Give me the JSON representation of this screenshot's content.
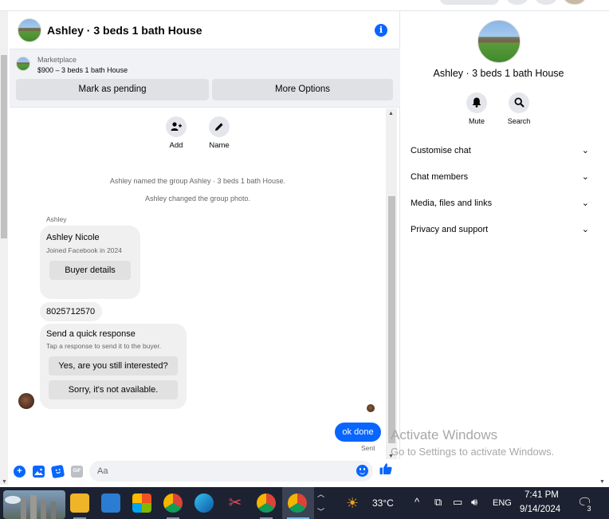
{
  "chat": {
    "title": "Ashley · 3 beds 1 bath House",
    "info_icon": "info-icon",
    "listing": {
      "label": "Marketplace",
      "price_title": "$900 – 3 beds 1 bath House",
      "mark_pending": "Mark as pending",
      "more_options": "More Options"
    },
    "actions": [
      {
        "label": "Add",
        "icon": "add-person-icon"
      },
      {
        "label": "Name",
        "icon": "pencil-icon"
      }
    ],
    "system_messages": [
      "Ashley named the group Ashley · 3 beds 1 bath House.",
      "Ashley changed the group photo."
    ],
    "sender_name": "Ashley",
    "profile_card": {
      "name": "Ashley Nicole",
      "joined": "Joined Facebook in 2024",
      "button": "Buyer details"
    },
    "phone_message": "8025712570",
    "quick_response": {
      "title": "Send a quick response",
      "subtitle": "Tap a response to send it to the buyer.",
      "option_1": "Yes, are you still interested?",
      "option_2": "Sorry, it's not available."
    },
    "outgoing_message": "ok done",
    "sent_status": "Sent",
    "composer": {
      "placeholder": "Aa",
      "gif_label": "GIF"
    }
  },
  "info_panel": {
    "name": "Ashley · 3 beds 1 bath House",
    "mute_label": "Mute",
    "search_label": "Search",
    "rows": [
      "Customise chat",
      "Chat members",
      "Media, files and links",
      "Privacy and support"
    ]
  },
  "watermark": {
    "title": "Activate Windows",
    "subtitle": "Go to Settings to activate Windows."
  },
  "taskbar": {
    "temperature": "33°C",
    "language": "ENG",
    "time": "7:41 PM",
    "date": "9/14/2024",
    "notification_count": "3"
  },
  "colors": {
    "accent": "#0866ff",
    "bubble_gray": "#f0f0f0",
    "taskbar": "#1c2231"
  }
}
